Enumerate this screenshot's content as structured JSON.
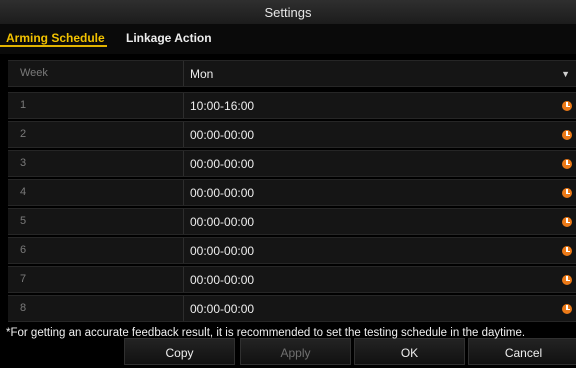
{
  "window": {
    "title": "Settings"
  },
  "tabs": [
    {
      "label": "Arming Schedule",
      "active": true
    },
    {
      "label": "Linkage Action",
      "active": false
    }
  ],
  "schedule": {
    "header": {
      "week_label": "Week",
      "day_value": "Mon"
    },
    "rows": [
      {
        "index": "1",
        "time": "10:00-16:00"
      },
      {
        "index": "2",
        "time": "00:00-00:00"
      },
      {
        "index": "3",
        "time": "00:00-00:00"
      },
      {
        "index": "4",
        "time": "00:00-00:00"
      },
      {
        "index": "5",
        "time": "00:00-00:00"
      },
      {
        "index": "6",
        "time": "00:00-00:00"
      },
      {
        "index": "7",
        "time": "00:00-00:00"
      },
      {
        "index": "8",
        "time": "00:00-00:00"
      }
    ]
  },
  "note": "*For getting an accurate feedback result, it is recommended to set the testing schedule in the daytime.",
  "buttons": {
    "copy": "Copy",
    "apply": "Apply",
    "ok": "OK",
    "cancel": "Cancel"
  },
  "colors": {
    "accent": "#f2c200",
    "clock_icon": "#ec7a18"
  }
}
